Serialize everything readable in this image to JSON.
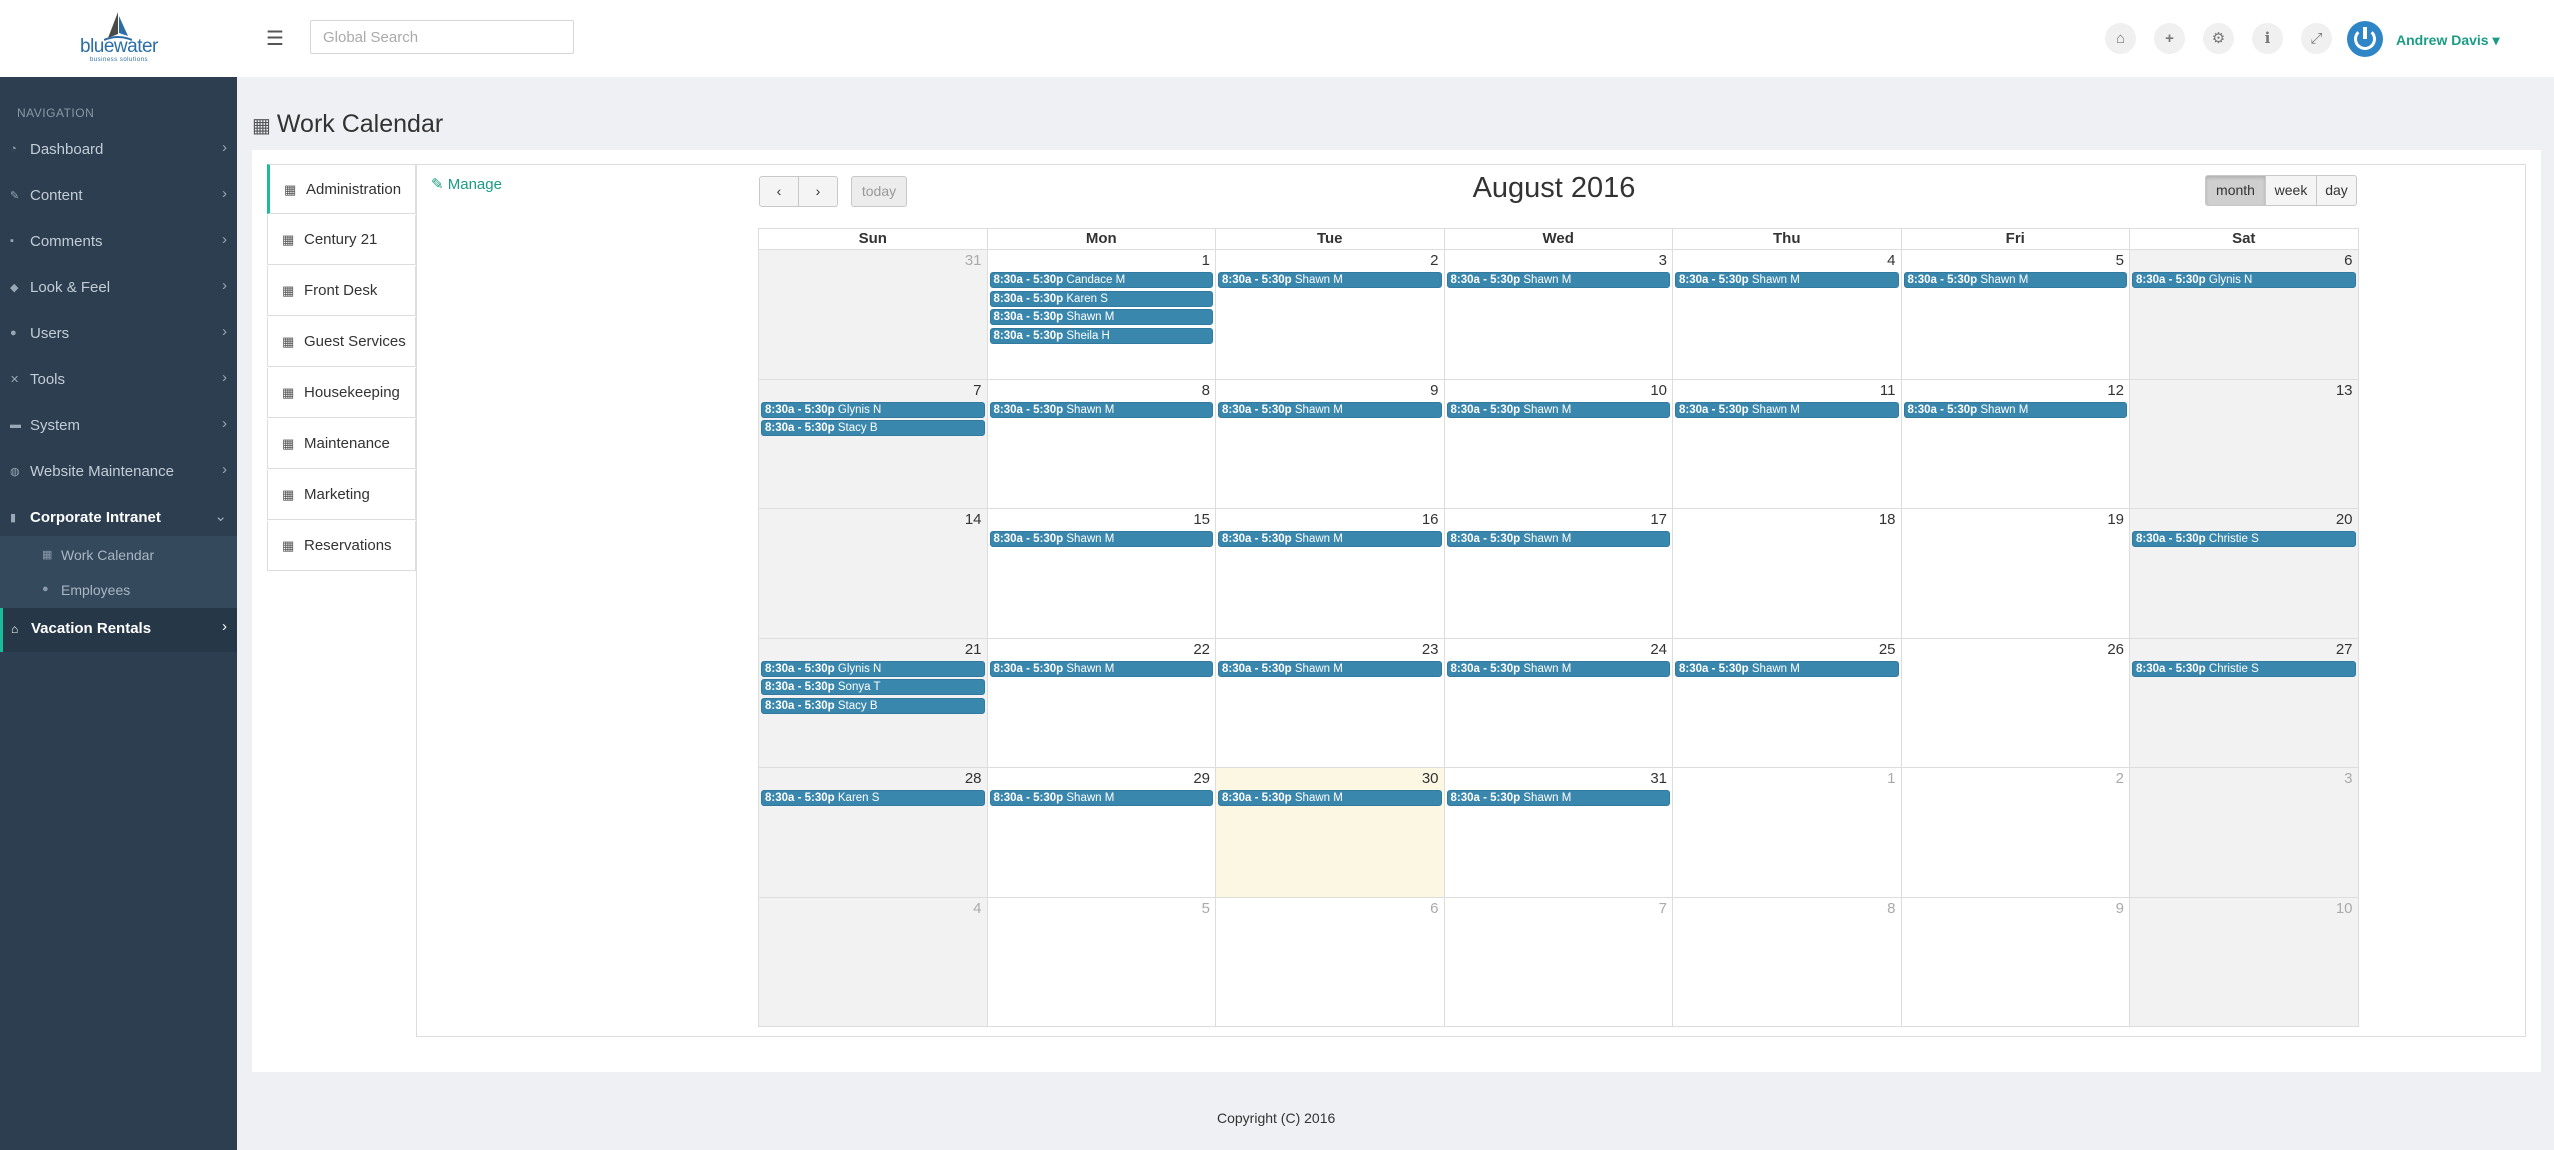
{
  "topbar": {
    "logo_text": "bluewater",
    "logo_sub": "business solutions",
    "search_placeholder": "Global Search",
    "icons": [
      "home-icon",
      "plus-icon",
      "gear-icon",
      "info-icon",
      "expand-icon"
    ],
    "user_name": "Andrew Davis"
  },
  "sidebar": {
    "nav_title": "NAVIGATION",
    "items": [
      {
        "label": "Dashboard",
        "icon": "dashboard-icon"
      },
      {
        "label": "Content",
        "icon": "pencil-icon"
      },
      {
        "label": "Comments",
        "icon": "comments-icon"
      },
      {
        "label": "Look & Feel",
        "icon": "drop-icon"
      },
      {
        "label": "Users",
        "icon": "user-icon"
      },
      {
        "label": "Tools",
        "icon": "wrench-icon"
      },
      {
        "label": "System",
        "icon": "hdd-icon"
      },
      {
        "label": "Website Maintenance",
        "icon": "globe-icon"
      },
      {
        "label": "Corporate Intranet",
        "icon": "book-icon"
      }
    ],
    "subitems": [
      {
        "label": "Work Calendar",
        "icon": "calendar-icon"
      },
      {
        "label": "Employees",
        "icon": "user-icon"
      }
    ],
    "vacation": {
      "label": "Vacation Rentals",
      "icon": "home-icon"
    }
  },
  "page": {
    "title": "Work Calendar",
    "manage_label": "Manage",
    "calendars": [
      "Administration",
      "Century 21",
      "Front Desk",
      "Guest Services",
      "Housekeeping",
      "Maintenance",
      "Marketing",
      "Reservations"
    ],
    "footer": "Copyright (C) 2016"
  },
  "calendar": {
    "title": "August 2016",
    "today_label": "today",
    "view_buttons": [
      "month",
      "week",
      "day"
    ],
    "active_view": "month",
    "days_of_week": [
      "Sun",
      "Mon",
      "Tue",
      "Wed",
      "Thu",
      "Fri",
      "Sat"
    ],
    "weeks": [
      [
        {
          "day": "31",
          "other": true,
          "events": []
        },
        {
          "day": "1",
          "events": [
            {
              "time": "8:30a - 5:30p",
              "name": "Candace M"
            },
            {
              "time": "8:30a - 5:30p",
              "name": "Karen S"
            },
            {
              "time": "8:30a - 5:30p",
              "name": "Shawn M"
            },
            {
              "time": "8:30a - 5:30p",
              "name": "Sheila H"
            }
          ]
        },
        {
          "day": "2",
          "events": [
            {
              "time": "8:30a - 5:30p",
              "name": "Shawn M"
            }
          ]
        },
        {
          "day": "3",
          "events": [
            {
              "time": "8:30a - 5:30p",
              "name": "Shawn M"
            }
          ]
        },
        {
          "day": "4",
          "events": [
            {
              "time": "8:30a - 5:30p",
              "name": "Shawn M"
            }
          ]
        },
        {
          "day": "5",
          "events": [
            {
              "time": "8:30a - 5:30p",
              "name": "Shawn M"
            }
          ]
        },
        {
          "day": "6",
          "events": [
            {
              "time": "8:30a - 5:30p",
              "name": "Glynis N"
            }
          ]
        }
      ],
      [
        {
          "day": "7",
          "events": [
            {
              "time": "8:30a - 5:30p",
              "name": "Glynis N"
            },
            {
              "time": "8:30a - 5:30p",
              "name": "Stacy B"
            }
          ]
        },
        {
          "day": "8",
          "events": [
            {
              "time": "8:30a - 5:30p",
              "name": "Shawn M"
            }
          ]
        },
        {
          "day": "9",
          "events": [
            {
              "time": "8:30a - 5:30p",
              "name": "Shawn M"
            }
          ]
        },
        {
          "day": "10",
          "events": [
            {
              "time": "8:30a - 5:30p",
              "name": "Shawn M"
            }
          ]
        },
        {
          "day": "11",
          "events": [
            {
              "time": "8:30a - 5:30p",
              "name": "Shawn M"
            }
          ]
        },
        {
          "day": "12",
          "events": [
            {
              "time": "8:30a - 5:30p",
              "name": "Shawn M"
            }
          ]
        },
        {
          "day": "13",
          "events": []
        }
      ],
      [
        {
          "day": "14",
          "events": []
        },
        {
          "day": "15",
          "events": [
            {
              "time": "8:30a - 5:30p",
              "name": "Shawn M"
            }
          ]
        },
        {
          "day": "16",
          "events": [
            {
              "time": "8:30a - 5:30p",
              "name": "Shawn M"
            }
          ]
        },
        {
          "day": "17",
          "events": [
            {
              "time": "8:30a - 5:30p",
              "name": "Shawn M"
            }
          ]
        },
        {
          "day": "18",
          "events": []
        },
        {
          "day": "19",
          "events": []
        },
        {
          "day": "20",
          "events": [
            {
              "time": "8:30a - 5:30p",
              "name": "Christie S"
            }
          ]
        }
      ],
      [
        {
          "day": "21",
          "events": [
            {
              "time": "8:30a - 5:30p",
              "name": "Glynis N"
            },
            {
              "time": "8:30a - 5:30p",
              "name": "Sonya T"
            },
            {
              "time": "8:30a - 5:30p",
              "name": "Stacy B"
            }
          ]
        },
        {
          "day": "22",
          "events": [
            {
              "time": "8:30a - 5:30p",
              "name": "Shawn M"
            }
          ]
        },
        {
          "day": "23",
          "events": [
            {
              "time": "8:30a - 5:30p",
              "name": "Shawn M"
            }
          ]
        },
        {
          "day": "24",
          "events": [
            {
              "time": "8:30a - 5:30p",
              "name": "Shawn M"
            }
          ]
        },
        {
          "day": "25",
          "events": [
            {
              "time": "8:30a - 5:30p",
              "name": "Shawn M"
            }
          ]
        },
        {
          "day": "26",
          "events": []
        },
        {
          "day": "27",
          "events": [
            {
              "time": "8:30a - 5:30p",
              "name": "Christie S"
            }
          ]
        }
      ],
      [
        {
          "day": "28",
          "events": [
            {
              "time": "8:30a - 5:30p",
              "name": "Karen S"
            }
          ]
        },
        {
          "day": "29",
          "events": [
            {
              "time": "8:30a - 5:30p",
              "name": "Shawn M"
            }
          ]
        },
        {
          "day": "30",
          "today": true,
          "events": [
            {
              "time": "8:30a - 5:30p",
              "name": "Shawn M"
            }
          ]
        },
        {
          "day": "31",
          "events": [
            {
              "time": "8:30a - 5:30p",
              "name": "Shawn M"
            }
          ]
        },
        {
          "day": "1",
          "other": true,
          "events": []
        },
        {
          "day": "2",
          "other": true,
          "events": []
        },
        {
          "day": "3",
          "other": true,
          "events": []
        }
      ],
      [
        {
          "day": "4",
          "other": true,
          "events": []
        },
        {
          "day": "5",
          "other": true,
          "events": []
        },
        {
          "day": "6",
          "other": true,
          "events": []
        },
        {
          "day": "7",
          "other": true,
          "events": []
        },
        {
          "day": "8",
          "other": true,
          "events": []
        },
        {
          "day": "9",
          "other": true,
          "events": []
        },
        {
          "day": "10",
          "other": true,
          "events": []
        }
      ]
    ]
  },
  "colors": {
    "sidebar": "#2c3e50",
    "accent": "#1abc9c",
    "event": "#3a87ad",
    "today": "#fcf7e3",
    "weekend": "#f2f2f2"
  }
}
